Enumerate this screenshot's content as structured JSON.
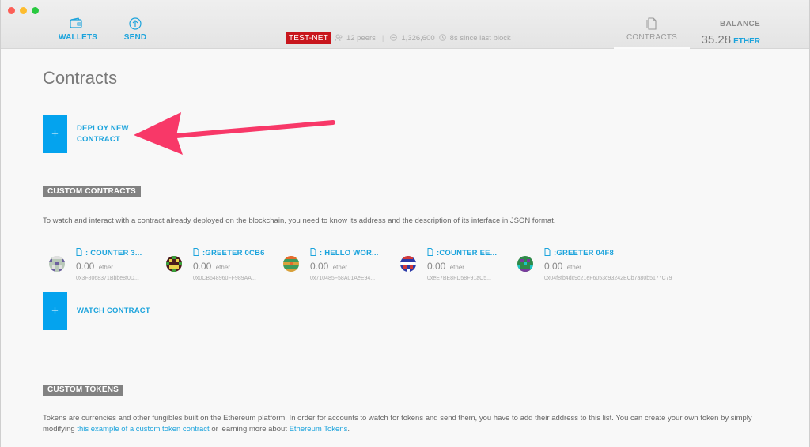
{
  "header": {
    "nav": {
      "wallets": "WALLETS",
      "send": "SEND",
      "contracts": "CONTRACTS"
    },
    "network": "TEST-NET",
    "peers": "12 peers",
    "block": "1,326,600",
    "since_block": "8s since last block",
    "balance_label": "BALANCE",
    "balance_value": "35.28",
    "balance_unit": "ETHER"
  },
  "page": {
    "title": "Contracts",
    "deploy_label": "DEPLOY NEW CONTRACT",
    "plus": "+",
    "custom_contracts_heading": "CUSTOM CONTRACTS",
    "custom_contracts_desc": "To watch and interact with a contract already deployed on the blockchain, you need to know its address and the description of its interface in JSON format.",
    "contracts": [
      {
        "name": ": COUNTER 3...",
        "amount": "0.00",
        "unit": "ether",
        "address": "0x3F8068371Bbbe8f0D..."
      },
      {
        "name": ":GREETER 0CB6",
        "amount": "0.00",
        "unit": "ether",
        "address": "0x0CB648960FF989AA..."
      },
      {
        "name": ": HELLO WOR...",
        "amount": "0.00",
        "unit": "ether",
        "address": "0x710485F58A01AeE94..."
      },
      {
        "name": ":COUNTER EE...",
        "amount": "0.00",
        "unit": "ether",
        "address": "0xeE7BE8FD58F91aC5..."
      },
      {
        "name": ":GREETER 04F8",
        "amount": "0.00",
        "unit": "ether",
        "address": "0x04f8fb4dc9c21eF6053c93242ECb7a80b5177C79"
      }
    ],
    "watch_label": "WATCH CONTRACT",
    "custom_tokens_heading": "CUSTOM TOKENS",
    "tokens_desc_1": "Tokens are currencies and other fungibles built on the Ethereum platform. In order for accounts to watch for tokens and send them, you have to add their address to this list. You can create your own token by simply modifying ",
    "tokens_link_1": "this example of a custom token contract",
    "tokens_desc_2": " or learning more about ",
    "tokens_link_2": "Ethereum Tokens",
    "tokens_desc_3": "."
  },
  "colors": {
    "accent": "#1ba3dc",
    "button": "#04a3ee",
    "testnet": "#c8161d",
    "arrow": "#f83868"
  },
  "icons": [
    "wallet-icon",
    "send-icon",
    "contracts-icon",
    "users-icon",
    "layers-icon",
    "clock-icon",
    "document-icon"
  ]
}
